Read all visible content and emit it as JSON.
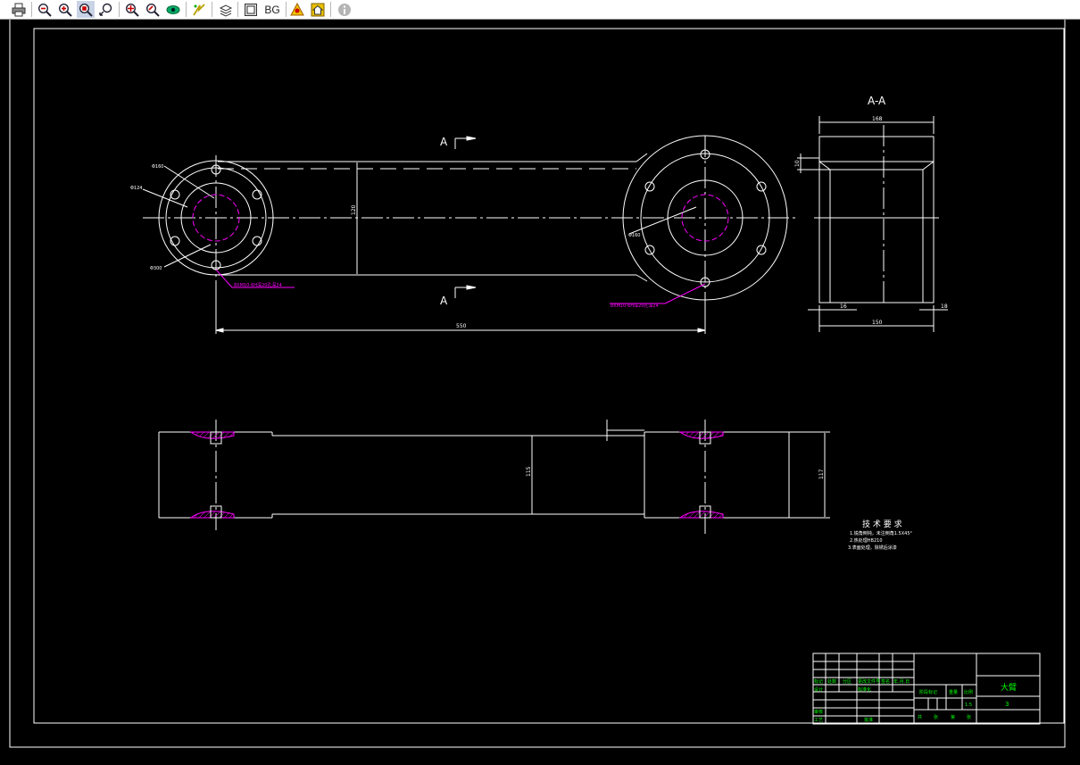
{
  "toolbar": {
    "items": [
      {
        "name": "print-icon"
      },
      {
        "name": "zoom-out-icon"
      },
      {
        "name": "zoom-in-icon"
      },
      {
        "name": "zoom-window-icon",
        "active": true
      },
      {
        "name": "zoom-realtime-icon"
      },
      {
        "name": "pan-icon"
      },
      {
        "name": "zoom-previous-icon"
      },
      {
        "name": "view-eye-icon"
      },
      {
        "name": "regen-icon"
      },
      {
        "name": "layers-icon"
      },
      {
        "name": "zoom-extents-icon"
      },
      {
        "name": "background-button",
        "label": "BG"
      },
      {
        "name": "named-views-icon"
      },
      {
        "name": "home-icon"
      },
      {
        "name": "info-icon",
        "disabled": true
      }
    ]
  },
  "drawing": {
    "colors": {
      "lines": "#ffffff",
      "annotations": "#ff00ff",
      "title_text": "#00ff00",
      "background": "#000000"
    },
    "section_title": "A-A",
    "section_marks": [
      "A",
      "A"
    ],
    "dimensions": {
      "overall_length": "550",
      "arm_height": "120",
      "section_width_top": "168",
      "section_width_bottom": "150",
      "section_left_offset": "16",
      "section_right_offset": "18",
      "section_top": "10",
      "bottom_height_mid": "115",
      "bottom_height_right": "117"
    },
    "hole_callouts": [
      "Φ160",
      "Φ124",
      "Φ300",
      "Φ160"
    ],
    "leader_notes": [
      "8XM10-6H深20孔深24",
      "8XM10-6H深20孔深24"
    ],
    "tech_requirements": {
      "title": "技 术 要 求",
      "lines": [
        "1.锐角倒钝，未注倒角1.5X45°",
        "2.热处理HB210",
        "3.表面处理，除锈后涂漆"
      ]
    },
    "title_block": {
      "part_name": "大臂",
      "sheet": "3",
      "scale": "1:5",
      "headers": [
        "标记",
        "处数",
        "分区",
        "更改文件号",
        "签名",
        "年.月.日"
      ],
      "row_labels": [
        "设计",
        "审核",
        "工艺",
        "标准化",
        "批准"
      ],
      "stage_headers": [
        "阶段标记",
        "重量",
        "比例"
      ],
      "sheet_labels": [
        "共",
        "张",
        "第",
        "张"
      ]
    }
  }
}
